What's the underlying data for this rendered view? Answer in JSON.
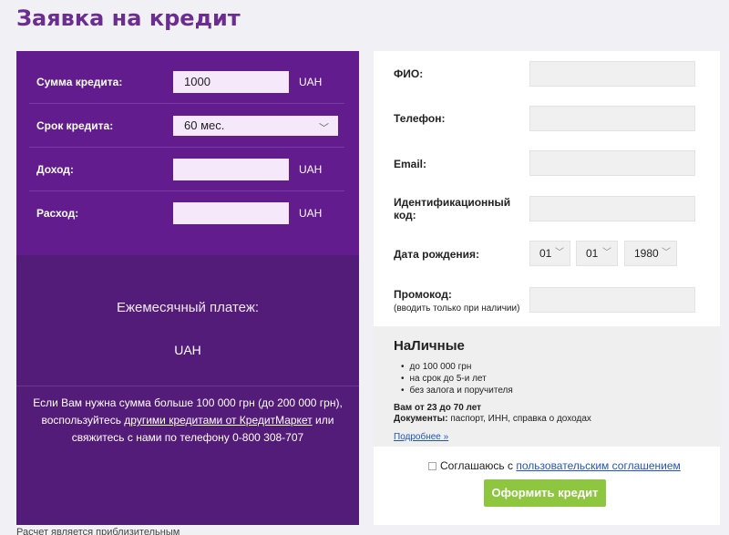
{
  "page_title": "Заявка на кредит",
  "calculator": {
    "amount": {
      "label": "Сумма кредита:",
      "value": "1000",
      "unit": "UAH"
    },
    "term": {
      "label": "Срок кредита:",
      "value": "60 мес."
    },
    "income": {
      "label": "Доход:",
      "value": "",
      "unit": "UAH"
    },
    "expense": {
      "label": "Расход:",
      "value": "",
      "unit": "UAH"
    },
    "payment_label": "Ежемесячный платеж:",
    "payment_unit": "UAH",
    "note": {
      "part1": "Если Вам нужна сумма больше 100 000 грн (до 200 000 грн), воспользуйтесь ",
      "link": "другими кредитами от КредитМаркет",
      "part2": " или свяжитесь с нами по телефону 0-800 308-707"
    }
  },
  "disclaimer": "Расчет является приблизительным",
  "form": {
    "fio_label": "ФИО:",
    "phone_label": "Телефон:",
    "email_label": "Email:",
    "inn_label": "Идентификационный код:",
    "birth_label": "Дата рождения:",
    "birth_day": "01",
    "birth_month": "01",
    "birth_year": "1980",
    "promo_label": "Промокод:",
    "promo_sub": "(вводить только при наличии)"
  },
  "promo": {
    "title": "НаЛичные",
    "items": [
      "до 100 000 грн",
      "на срок до 5-и лет",
      "без залога и поручителя"
    ],
    "age": "Вам от 23 до 70 лет",
    "docs_label": "Документы:",
    "docs_value": " паспорт, ИНН, справка о доходах",
    "more": "Подробнее »"
  },
  "agreement": {
    "text": "Соглашаюсь с ",
    "link": "пользовательским соглашением"
  },
  "submit_label": "Оформить кредит",
  "colors": {
    "title": "#6b2d91",
    "panel_top": "#631c8e",
    "panel_bottom": "#531c78",
    "button": "#8ec63f"
  }
}
